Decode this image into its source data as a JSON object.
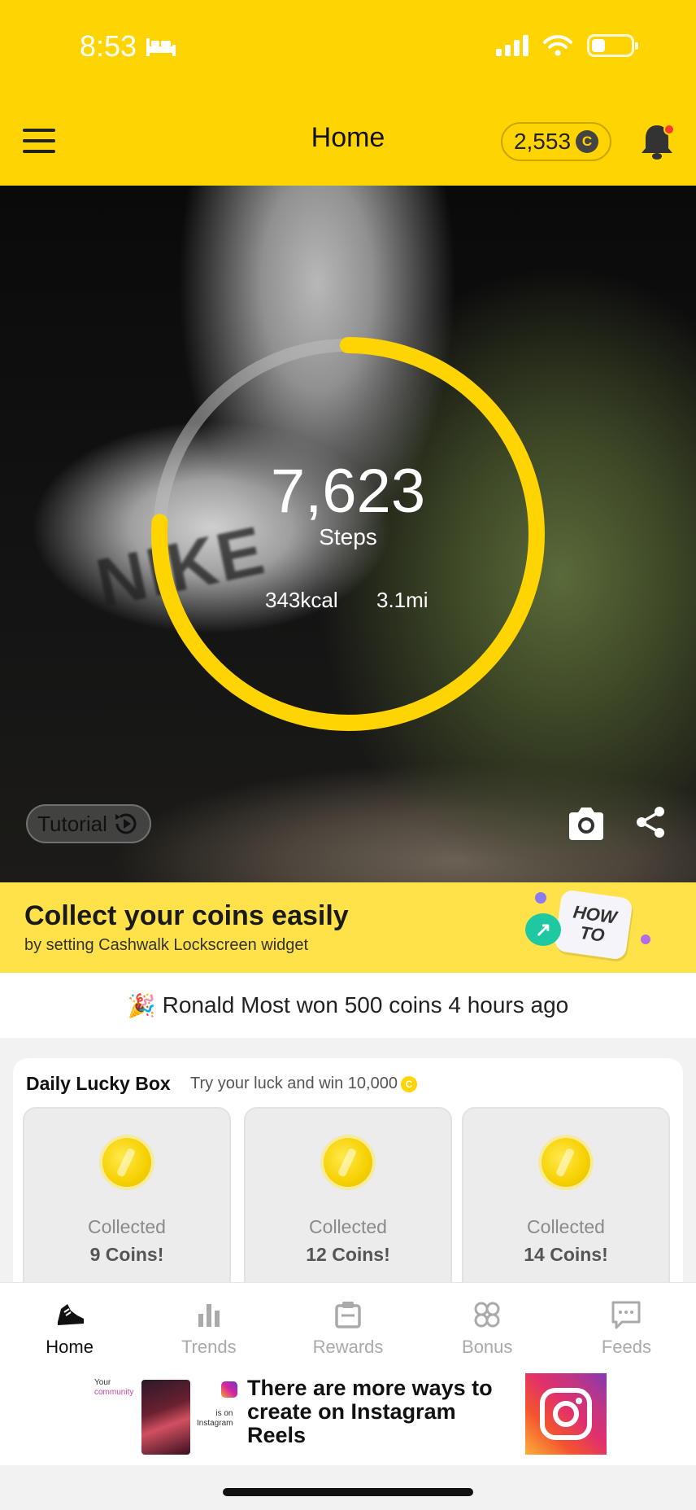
{
  "status_bar": {
    "time": "8:53"
  },
  "header": {
    "title": "Home",
    "coin_balance": "2,553",
    "coin_symbol": "C"
  },
  "hero": {
    "background_text": "NIKE",
    "steps": "7,623",
    "steps_label": "Steps",
    "kcal": "343kcal",
    "distance": "3.1mi",
    "ring_progress": 0.76,
    "tutorial_label": "Tutorial"
  },
  "banner": {
    "headline": "Collect your coins easily",
    "subline": "by setting Cashwalk Lockscreen widget",
    "howto": "HOW TO"
  },
  "ticker": {
    "emoji": "🎉",
    "text": "Ronald Most won 500 coins 4 hours ago"
  },
  "lucky_box": {
    "title": "Daily Lucky Box",
    "subtitle": "Try your luck and win 10,000",
    "boxes": [
      {
        "label": "Collected",
        "value": "9 Coins!"
      },
      {
        "label": "Collected",
        "value": "12 Coins!"
      },
      {
        "label": "Collected",
        "value": "14 Coins!"
      }
    ]
  },
  "tabs": [
    {
      "label": "Home",
      "icon": "sneaker-icon",
      "active": true
    },
    {
      "label": "Trends",
      "icon": "bar-chart-icon",
      "active": false
    },
    {
      "label": "Rewards",
      "icon": "clipboard-icon",
      "active": false
    },
    {
      "label": "Bonus",
      "icon": "clover-icon",
      "active": false
    },
    {
      "label": "Feeds",
      "icon": "chat-icon",
      "active": false
    }
  ],
  "ad": {
    "your": "Your",
    "community": "community",
    "is_on": "is on",
    "instagram": "Instagram",
    "text": "There are more ways to create on Instagram Reels"
  },
  "colors": {
    "brand_yellow": "#ffd400",
    "banner_yellow": "#ffe24a",
    "notification_red": "#ff3b30"
  }
}
